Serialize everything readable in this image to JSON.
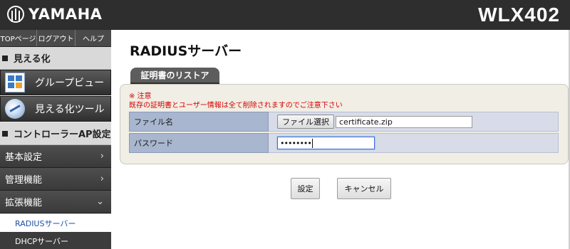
{
  "header": {
    "brand": "YAMAHA",
    "model": "WLX402"
  },
  "sidebar": {
    "topnav": [
      "TOPページ",
      "ログアウト",
      "ヘルプ"
    ],
    "visualize_heading": "見える化",
    "tools": [
      "グループビュー",
      "見える化ツール"
    ],
    "controller_heading": "コントローラーAP設定",
    "nav_items": [
      {
        "label": "基本設定",
        "chevron": "›"
      },
      {
        "label": "管理機能",
        "chevron": "›"
      },
      {
        "label": "拡張機能",
        "chevron": "⌄"
      }
    ],
    "sub_items": [
      "RADIUSサーバー",
      "DHCPサーバー"
    ]
  },
  "main": {
    "title": "RADIUSサーバー",
    "tab_label": "証明書のリストア",
    "notice_line1": "※ 注意",
    "notice_line2": "既存の証明書とユーザー情報は全て削除されますのでご注意下さい",
    "file_label": "ファイル名",
    "file_button": "ファイル選択",
    "file_value": "certificate.zip",
    "password_label": "パスワード",
    "password_value": "••••••••",
    "save_button": "設定",
    "cancel_button": "キャンセル"
  },
  "colors": {
    "header_bg": "#2e2e2e",
    "notice": "#d40000",
    "label_bg": "#a8b6cf",
    "value_bg": "#d8dce9",
    "active_link": "#1d4fa0"
  }
}
